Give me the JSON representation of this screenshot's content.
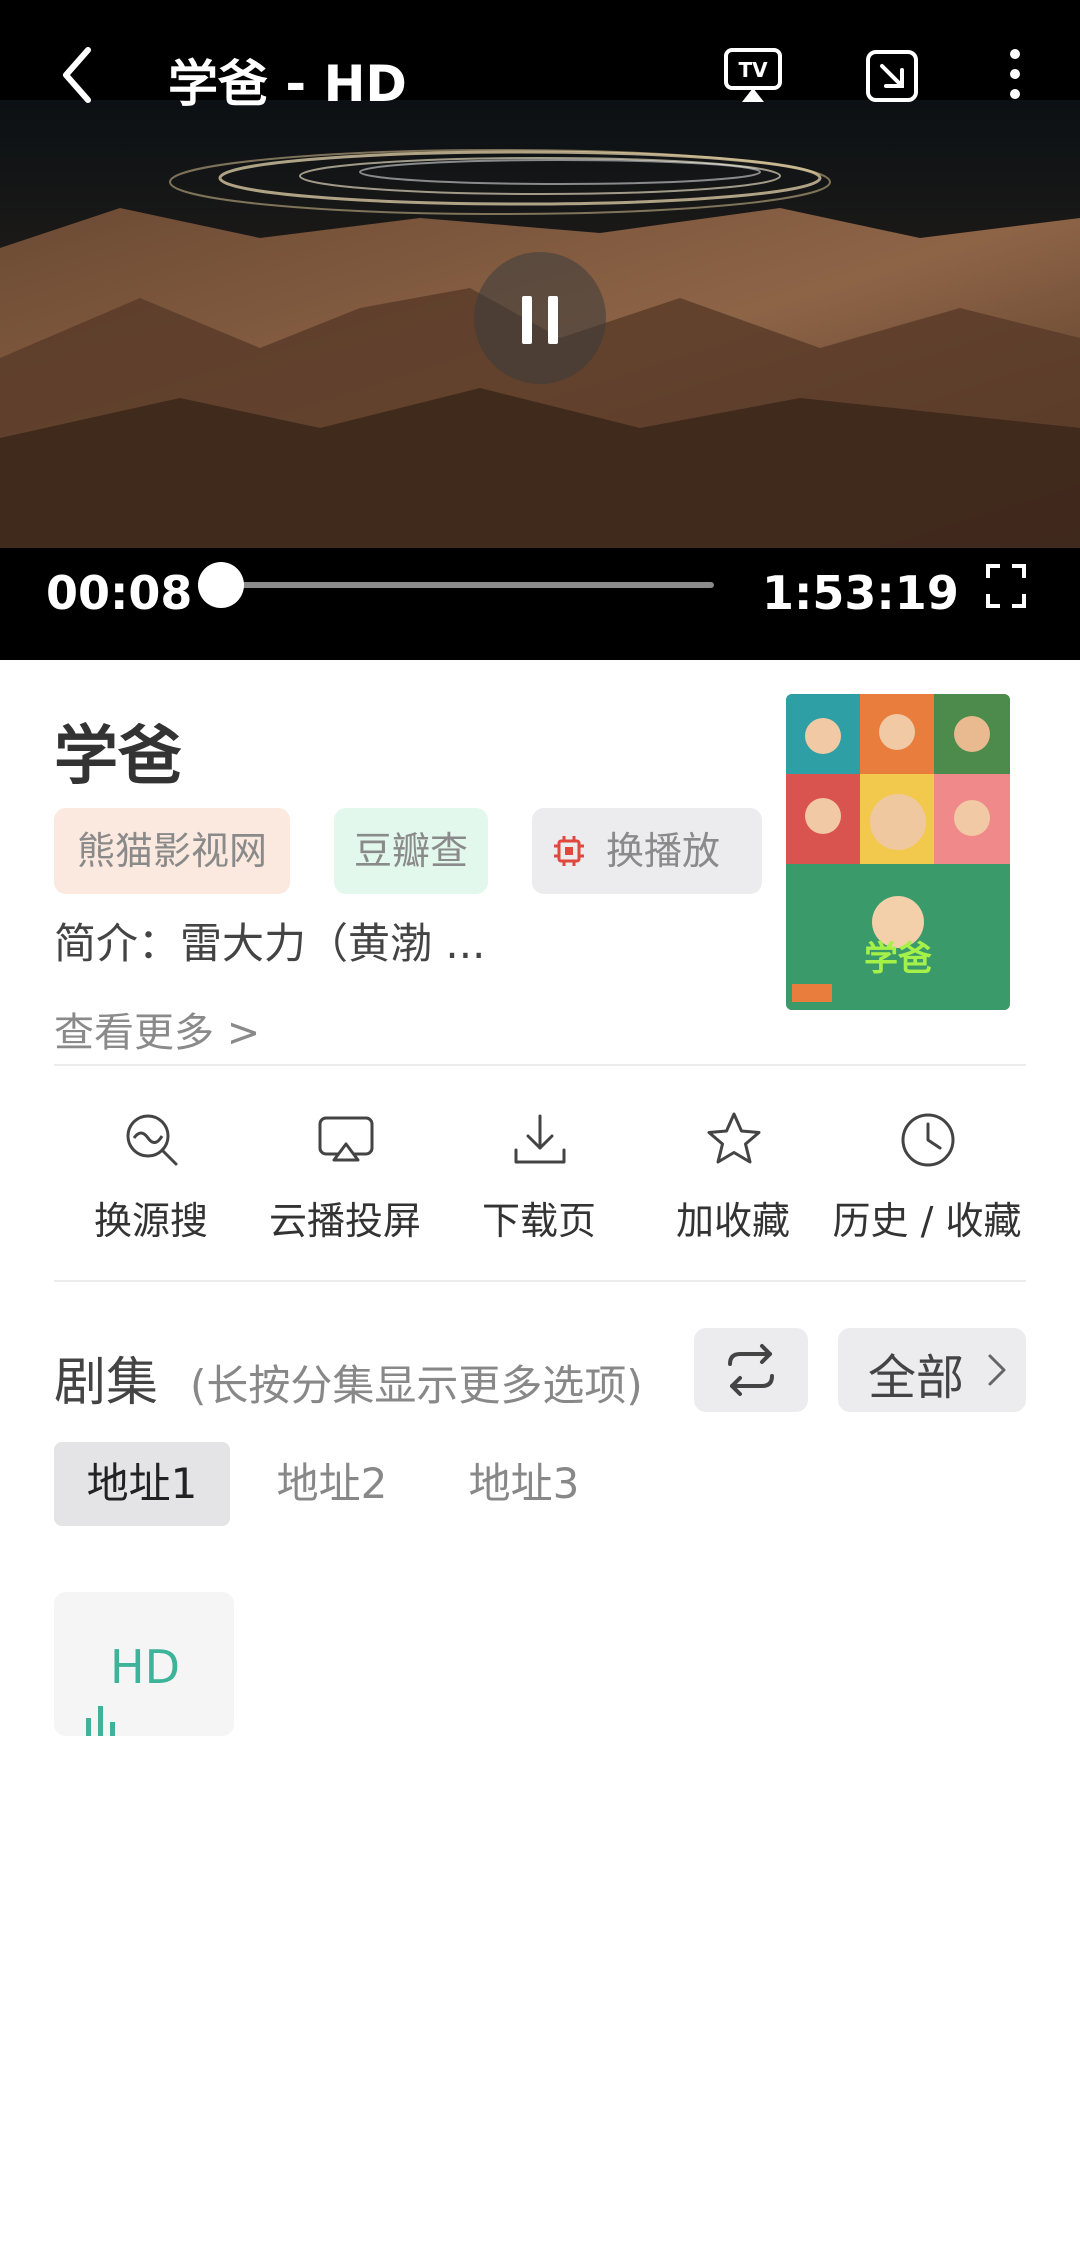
{
  "player": {
    "title": "学爸 - HD",
    "time_current": "00:08",
    "time_total": "1:53:19",
    "progress": 0.0012,
    "icons": [
      "back-arrow-icon",
      "tv-cast-icon",
      "picture-in-picture-icon",
      "more-vertical-icon",
      "pause-icon",
      "fullscreen-icon"
    ]
  },
  "info": {
    "title": "学爸",
    "tags": {
      "source": "熊猫影视网",
      "douban": "豆瓣查",
      "switch": "换播放"
    },
    "synopsis": "简介：雷大力（黄渤 ...",
    "see_more": "查看更多 >"
  },
  "actions": [
    {
      "label": "换源搜",
      "icon": "search-wave-icon"
    },
    {
      "label": "云播投屏",
      "icon": "airplay-icon"
    },
    {
      "label": "下载页",
      "icon": "download-icon"
    },
    {
      "label": "加收藏",
      "icon": "star-icon"
    },
    {
      "label": "历史 / 收藏",
      "icon": "clock-icon"
    }
  ],
  "episodes": {
    "title": "剧集",
    "hint": "(长按分集显示更多选项)",
    "all_label": "全部",
    "sources": [
      "地址1",
      "地址2",
      "地址3"
    ],
    "selected_source": "地址1",
    "items": [
      {
        "label": "HD",
        "playing": true
      }
    ]
  },
  "colors": {
    "accent_green": "#3db39a",
    "tag_source_bg": "#fbe9df",
    "tag_douban_bg": "#e2f8ec",
    "chip_red": "#e0483e"
  }
}
